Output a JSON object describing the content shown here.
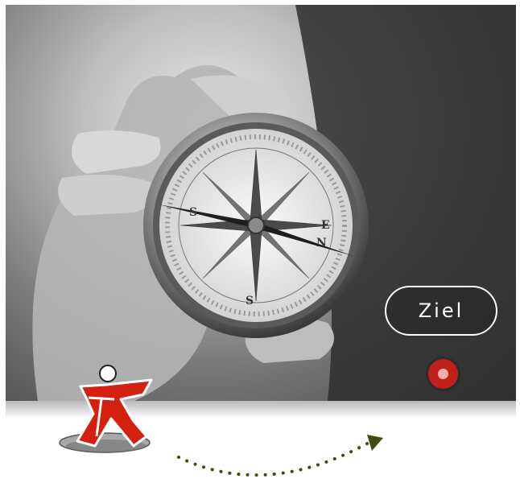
{
  "goal": {
    "label": "Ziel"
  },
  "colors": {
    "accent_red": "#c0201a",
    "path_green": "#3f4d14",
    "photo_tone": "grayscale"
  },
  "icons": {
    "figure": "climbing-figure-icon",
    "target": "target-dot-icon",
    "path": "dotted-arrow-icon"
  }
}
